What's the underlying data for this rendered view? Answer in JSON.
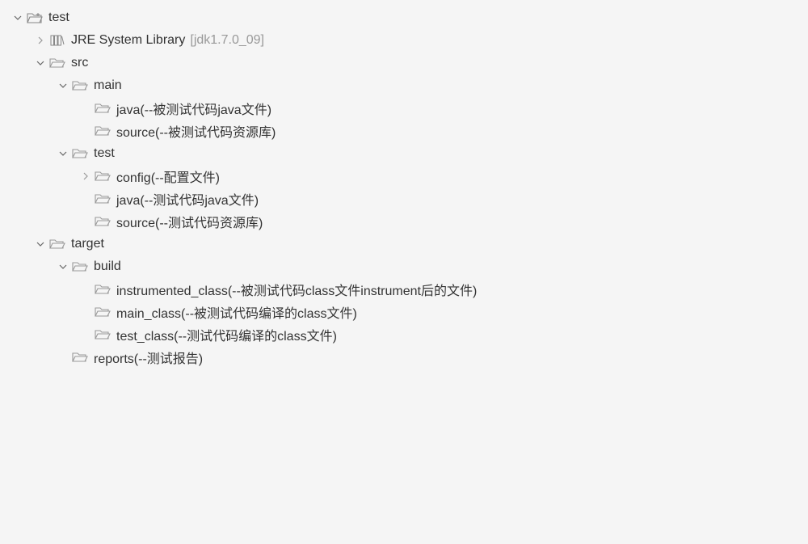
{
  "tree": {
    "label": "test",
    "icon": "project",
    "arrow": "expanded",
    "children": [
      {
        "label": "JRE System Library",
        "suffix": "[jdk1.7.0_09]",
        "icon": "library",
        "arrow": "collapsed"
      },
      {
        "label": "src",
        "icon": "folder-open",
        "arrow": "expanded",
        "children": [
          {
            "label": "main",
            "icon": "folder-open",
            "arrow": "expanded",
            "children": [
              {
                "label": "java(--被测试代码java文件)",
                "icon": "folder-open",
                "arrow": "none"
              },
              {
                "label": "source(--被测试代码资源库)",
                "icon": "folder-open",
                "arrow": "none"
              }
            ]
          },
          {
            "label": "test",
            "icon": "folder-open",
            "arrow": "expanded",
            "children": [
              {
                "label": "config(--配置文件)",
                "icon": "folder-open",
                "arrow": "collapsed"
              },
              {
                "label": "java(--测试代码java文件)",
                "icon": "folder-open",
                "arrow": "none"
              },
              {
                "label": "source(--测试代码资源库)",
                "icon": "folder-open",
                "arrow": "none"
              }
            ]
          }
        ]
      },
      {
        "label": "target",
        "icon": "folder-open",
        "arrow": "expanded",
        "children": [
          {
            "label": "build",
            "icon": "folder-open",
            "arrow": "expanded",
            "children": [
              {
                "label": "instrumented_class(--被测试代码class文件instrument后的文件)",
                "icon": "folder-open",
                "arrow": "none"
              },
              {
                "label": "main_class(--被测试代码编译的class文件)",
                "icon": "folder-open",
                "arrow": "none"
              },
              {
                "label": "test_class(--测试代码编译的class文件)",
                "icon": "folder-open",
                "arrow": "none"
              }
            ]
          },
          {
            "label": "reports(--测试报告)",
            "icon": "folder-open",
            "arrow": "none"
          }
        ]
      }
    ]
  }
}
